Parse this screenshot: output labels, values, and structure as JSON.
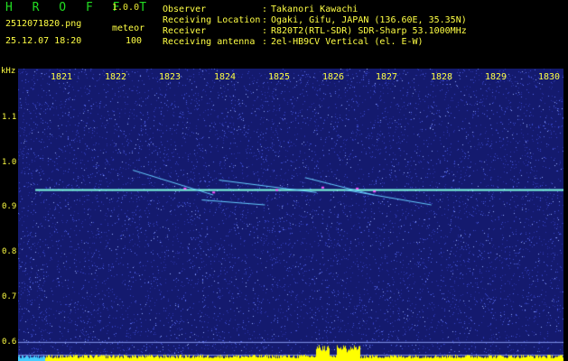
{
  "header": {
    "app_title": "H R O F F T",
    "app_version": "1.0.0",
    "filename": "2512071820.png",
    "datetime": "25.12.07 18:20",
    "mode": "meteor",
    "count": "100"
  },
  "info": [
    {
      "label": "Observer",
      "sep": ":",
      "value": "Takanori Kawachi"
    },
    {
      "label": "Receiving Location",
      "sep": ":",
      "value": "Ogaki, Gifu, JAPAN (136.60E, 35.35N)"
    },
    {
      "label": "Receiver",
      "sep": ":",
      "value": "R820T2(RTL-SDR) SDR-Sharp 53.1000MHz"
    },
    {
      "label": "Receiving antenna",
      "sep": ":",
      "value": "2el-HB9CV Vertical (el. E-W)"
    }
  ],
  "axes": {
    "y_unit": "kHz",
    "y_ticks": [
      "1.1",
      "1.0",
      "0.9",
      "0.8",
      "0.7",
      "0.6"
    ],
    "x_ticks": [
      "1821",
      "1822",
      "1823",
      "1824",
      "1825",
      "1826",
      "1827",
      "1828",
      "1829",
      "1830"
    ]
  },
  "colors": {
    "background": "#141a6e",
    "carrier": "#7fffe0",
    "text": "#ffff44",
    "title": "#22dd22",
    "bars": "#ffff00"
  },
  "chart_data": {
    "type": "spectrogram",
    "x_axis": "time (minutes)",
    "xlim": [
      1820.7,
      1830.2
    ],
    "ylim": [
      0.58,
      1.17
    ],
    "carrier_khz": 0.925,
    "meteor_echoes": [
      {
        "t_start": 1822.7,
        "t_end": 1824.1,
        "f_start": 0.965,
        "f_end": 0.915
      },
      {
        "t_start": 1823.9,
        "t_end": 1825.0,
        "f_start": 0.905,
        "f_end": 0.895
      },
      {
        "t_start": 1824.2,
        "t_end": 1825.9,
        "f_start": 0.945,
        "f_end": 0.92
      },
      {
        "t_start": 1825.7,
        "t_end": 1826.9,
        "f_start": 0.95,
        "f_end": 0.915
      },
      {
        "t_start": 1826.4,
        "t_end": 1827.9,
        "f_start": 0.925,
        "f_end": 0.895
      }
    ]
  }
}
